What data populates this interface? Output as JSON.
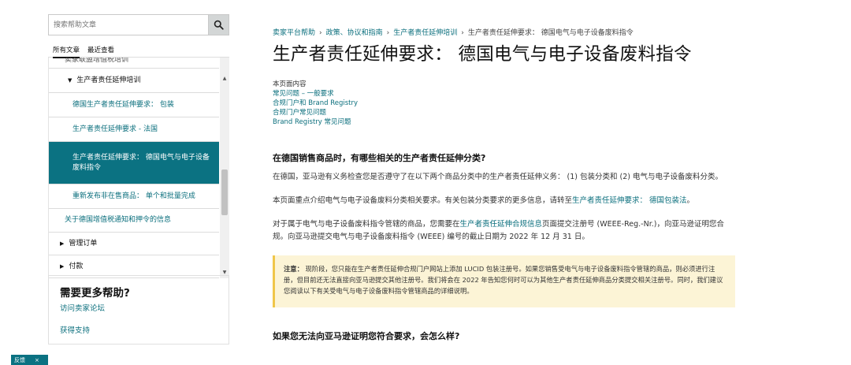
{
  "sidebar": {
    "search_placeholder": "搜索帮助文章",
    "tabs": [
      {
        "label": "所有文章"
      },
      {
        "label": "最近查看"
      }
    ],
    "nav": {
      "clipped": "卖家联盟增值税培训",
      "parent": "生产者责任延伸培训",
      "children": [
        "德国生产者责任延伸要求： 包装",
        "生产者责任延伸要求 - 法国",
        "生产者责任延伸要求： 德国电气与电子设备废料指令",
        "重新发布非在售商品： 单个和批量完成"
      ],
      "level1": "关于德国增值税通知和押令的信息",
      "sections": [
        "管理订单",
        "付款"
      ]
    },
    "help": {
      "title": "需要更多帮助?",
      "forum": "访问卖家论坛",
      "support": "获得支持"
    },
    "feedback": {
      "label": "反馈",
      "close": "×"
    }
  },
  "main": {
    "breadcrumb": [
      "卖家平台帮助",
      "政策、协议和指南",
      "生产者责任延伸培训",
      "生产者责任延伸要求： 德国电气与电子设备废料指令"
    ],
    "title": "生产者责任延伸要求： 德国电气与电子设备废料指令",
    "toc_title": "本页面内容",
    "toc_links": [
      "常见问题 – 一般要求",
      "合规门户和 Brand Registry",
      "合规门户常见问题",
      "Brand Registry 常见问题"
    ],
    "section1": {
      "heading": "在德国销售商品时，有哪些相关的生产者责任延伸分类?",
      "p1": "在德国，亚马逊有义务检查您是否遵守了在以下两个商品分类中的生产者责任延伸义务： (1) 包装分类和 (2) 电气与电子设备废料分类。",
      "p2_pre": "本页面重点介绍电气与电子设备废料分类相关要求。有关包装分类要求的更多信息，请转至",
      "p2_link": "生产者责任延伸要求： 德国包装法",
      "p2_post": "。",
      "p3_pre": "对于属于电气与电子设备废料指令管辖的商品，您需要在",
      "p3_link": "生产者责任延伸合规信息",
      "p3_post": "页面提交注册号 (WEEE-Reg.-Nr.)，向亚马逊证明您合规。向亚马逊提交电气与电子设备废料指令 (WEEE) 编号的截止日期为 2022 年 12 月 31 日。"
    },
    "note": {
      "label": "注意：",
      "text": " 现阶段，您只能在生产者责任延伸合规门户网站上添加 LUCID 包装注册号。如果您销售受电气与电子设备废料指令管辖的商品，则必须进行注册，但目前还无法直接向亚马逊提交其他注册号。我们将会在 2022 年告知您何时可以为其他生产者责任延伸商品分类提交相关注册号。同时，我们建议您阅读以下有关受电气与电子设备废料指令管辖商品的详细说明。"
    },
    "next_heading": "如果您无法向亚马逊证明您符合要求，会怎么样?"
  }
}
